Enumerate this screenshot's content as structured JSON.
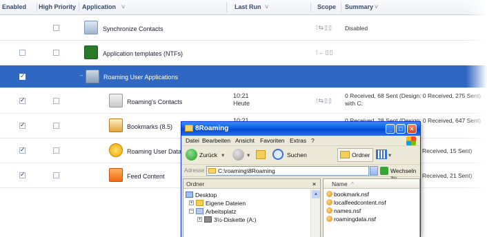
{
  "columns": {
    "enabled": "Enabled",
    "high_priority": "High Priority",
    "application": "Application",
    "last_run": "Last Run",
    "scope": "Scope",
    "summary": "Summary"
  },
  "rows": [
    {
      "application": "Synchronize Contacts",
      "enabled": false,
      "high_priority": false,
      "last_run": [
        "",
        ""
      ],
      "summary": [
        "Disabled",
        ""
      ],
      "icon": "sync-contacts-icon"
    },
    {
      "application": "Application templates (NTFs)",
      "enabled": false,
      "high_priority": false,
      "last_run": [
        "",
        ""
      ],
      "summary": [
        "",
        ""
      ],
      "icon": "app-templates-icon"
    },
    {
      "application": "Roaming User Applications",
      "enabled": true,
      "high_priority": null,
      "last_run": [
        "",
        ""
      ],
      "summary": [
        "",
        ""
      ],
      "icon": "roaming-group-icon",
      "selected": true
    },
    {
      "application": "Roaming's Contacts",
      "enabled": true,
      "high_priority": false,
      "last_run": [
        "10:21",
        "Heute"
      ],
      "summary": [
        "0 Received, 68 Sent   (Design: 0 Received, 275 Sent)",
        "with C:"
      ],
      "icon": "contacts-icon"
    },
    {
      "application": "Bookmarks (8.5)",
      "enabled": true,
      "high_priority": false,
      "last_run": [
        "10:21",
        ""
      ],
      "summary": [
        "0 Received, 28 Sent   (Design: 0 Received, 647 Sent)",
        ""
      ],
      "icon": "bookmarks-icon"
    },
    {
      "application": "Roaming User Data",
      "enabled": true,
      "high_priority": false,
      "last_run": [
        "",
        ""
      ],
      "summary": [
        "Received, 15 Sent)",
        ""
      ],
      "icon": "roaming-data-icon"
    },
    {
      "application": "Feed Content",
      "enabled": true,
      "high_priority": false,
      "last_run": [
        "",
        ""
      ],
      "summary": [
        "Received, 21 Sent)",
        ""
      ],
      "icon": "feed-icon"
    }
  ],
  "explorer": {
    "title": "8Roaming",
    "menu": [
      "Datei",
      "Bearbeiten",
      "Ansicht",
      "Favoriten",
      "Extras",
      "?"
    ],
    "toolbar": {
      "back": "Zurück",
      "search": "Suchen",
      "folders": "Ordner"
    },
    "address_label": "Adresse",
    "address_value": "C:\\roaming\\8Roaming",
    "go_label": "Wechseln zu",
    "folders_pane_title": "Ordner",
    "folders_pane_close": "×",
    "tree": [
      "Desktop",
      "Eigene Dateien",
      "Arbeitsplatz",
      "3½-Diskette (A:)"
    ],
    "files_header": "Name",
    "files": [
      "bookmark.nsf",
      "localfeedcontent.nsf",
      "names.nsf",
      "roamingdata.nsf"
    ]
  },
  "colors": {
    "selection": "#2f68c2",
    "xp_title": "#0a5ce0",
    "header_text": "#3a4a6a"
  }
}
